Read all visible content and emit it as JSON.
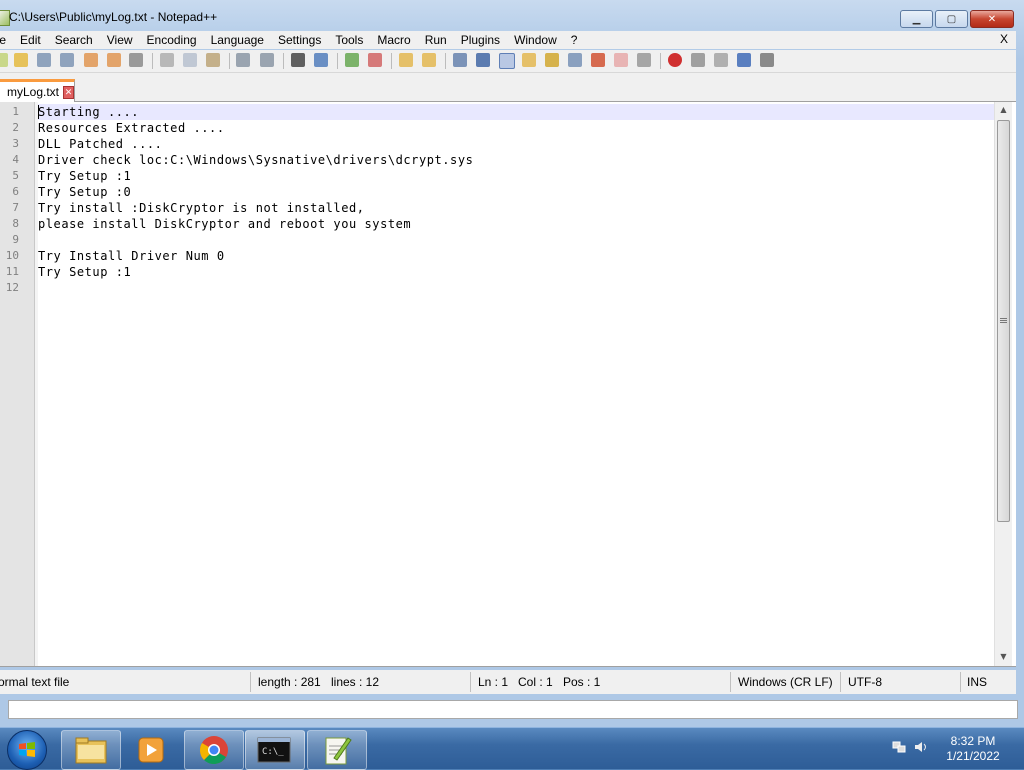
{
  "window": {
    "title": "C:\\Users\\Public\\myLog.txt - Notepad++",
    "minimize_glyph": "▁",
    "maximize_glyph": "▢",
    "close_glyph": "✕"
  },
  "menu": {
    "items": [
      "ile",
      "Edit",
      "Search",
      "View",
      "Encoding",
      "Language",
      "Settings",
      "Tools",
      "Macro",
      "Run",
      "Plugins",
      "Window",
      "?"
    ],
    "close_label": "X"
  },
  "tab": {
    "label": "myLog.txt",
    "close_glyph": "✕"
  },
  "editor": {
    "lines": [
      {
        "num": "1",
        "text": "Starting ...."
      },
      {
        "num": "2",
        "text": "Resources Extracted ...."
      },
      {
        "num": "3",
        "text": "DLL Patched ...."
      },
      {
        "num": "4",
        "text": "Driver check loc:C:\\Windows\\Sysnative\\drivers\\dcrypt.sys"
      },
      {
        "num": "5",
        "text": "Try Setup :1"
      },
      {
        "num": "6",
        "text": "Try Setup :0"
      },
      {
        "num": "7",
        "text": "Try install :DiskCryptor is not installed,"
      },
      {
        "num": "8",
        "text": "please install DiskCryptor and reboot you system"
      },
      {
        "num": "9",
        "text": ""
      },
      {
        "num": "10",
        "text": "Try Install Driver Num 0"
      },
      {
        "num": "11",
        "text": "Try Setup :1"
      },
      {
        "num": "12",
        "text": ""
      }
    ],
    "current_line": 1
  },
  "status": {
    "file_type": "ormal text file",
    "length": "length : 281",
    "lines": "lines : 12",
    "ln": "Ln : 1",
    "col": "Col : 1",
    "pos": "Pos : 1",
    "eol": "Windows (CR LF)",
    "encoding": "UTF-8",
    "mode": "INS"
  },
  "taskbar": {
    "clock_time": "8:32 PM",
    "clock_date": "1/21/2022",
    "apps": [
      "file-explorer",
      "media-player",
      "chrome",
      "command-prompt",
      "notepad-plus-plus"
    ]
  },
  "colors": {
    "tab_accent": "#fa9b3f",
    "current_line": "#e8e8ff",
    "gutter": "#e4e4e4"
  }
}
